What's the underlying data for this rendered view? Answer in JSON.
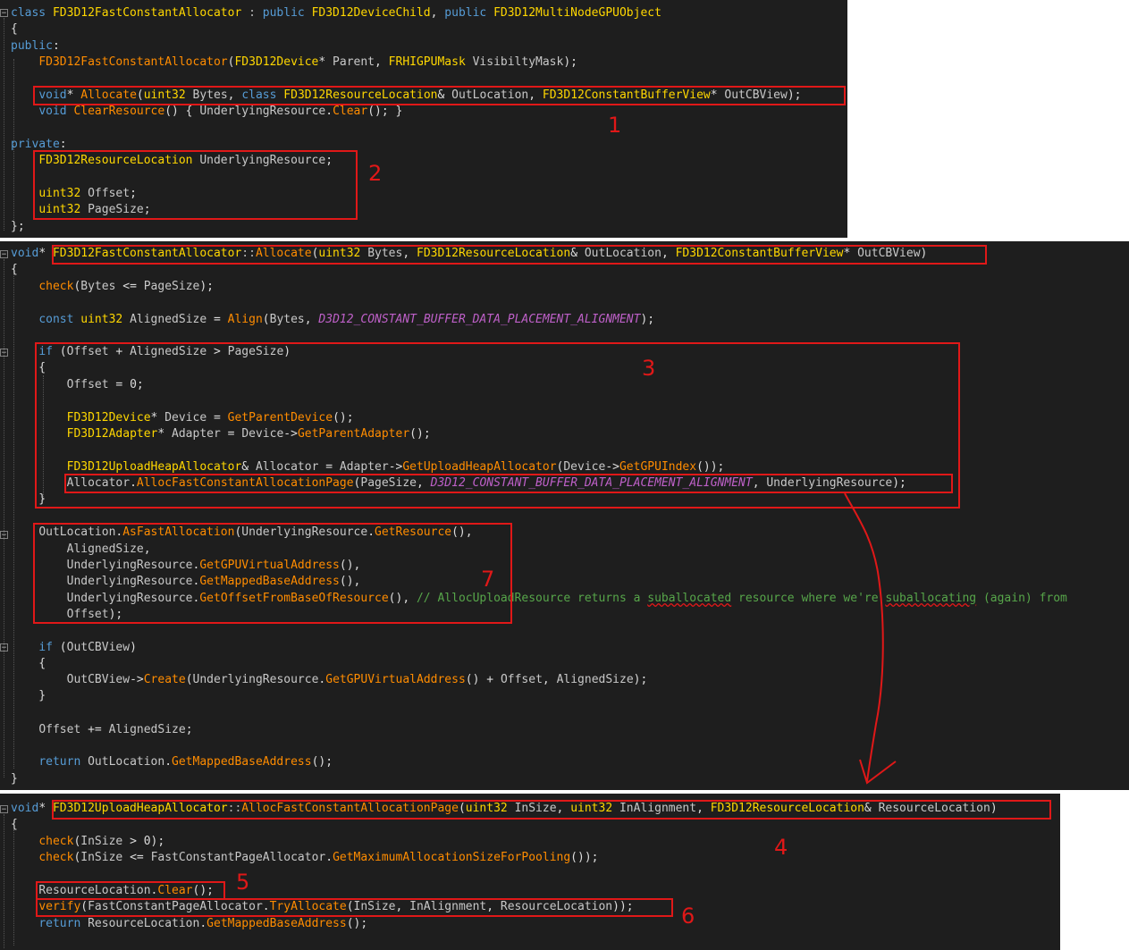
{
  "panel1": {
    "lines": [
      "class FD3D12FastConstantAllocator : public FD3D12DeviceChild, public FD3D12MultiNodeGPUObject",
      "{",
      "public:",
      "    FD3D12FastConstantAllocator(FD3D12Device* Parent, FRHIGPUMask VisibiltyMask);",
      "",
      "    void* Allocate(uint32 Bytes, class FD3D12ResourceLocation& OutLocation, FD3D12ConstantBufferView* OutCBView);",
      "    void ClearResource() { UnderlyingResource.Clear(); }",
      "",
      "private:",
      "    FD3D12ResourceLocation UnderlyingResource;",
      "",
      "    uint32 Offset;",
      "    uint32 PageSize;",
      "};"
    ]
  },
  "panel2": {
    "lines": [
      "void* FD3D12FastConstantAllocator::Allocate(uint32 Bytes, FD3D12ResourceLocation& OutLocation, FD3D12ConstantBufferView* OutCBView)",
      "{",
      "    check(Bytes <= PageSize);",
      "",
      "    const uint32 AlignedSize = Align(Bytes, D3D12_CONSTANT_BUFFER_DATA_PLACEMENT_ALIGNMENT);",
      "",
      "    if (Offset + AlignedSize > PageSize)",
      "    {",
      "        Offset = 0;",
      "",
      "        FD3D12Device* Device = GetParentDevice();",
      "        FD3D12Adapter* Adapter = Device->GetParentAdapter();",
      "",
      "        FD3D12UploadHeapAllocator& Allocator = Adapter->GetUploadHeapAllocator(Device->GetGPUIndex());",
      "        Allocator.AllocFastConstantAllocationPage(PageSize, D3D12_CONSTANT_BUFFER_DATA_PLACEMENT_ALIGNMENT, UnderlyingResource);",
      "    }",
      "",
      "    OutLocation.AsFastAllocation(UnderlyingResource.GetResource(),",
      "        AlignedSize,",
      "        UnderlyingResource.GetGPUVirtualAddress(),",
      "        UnderlyingResource.GetMappedBaseAddress(),",
      "        UnderlyingResource.GetOffsetFromBaseOfResource(), // AllocUploadResource returns a suballocated resource where we're suballocating (again) from",
      "        Offset);",
      "",
      "    if (OutCBView)",
      "    {",
      "        OutCBView->Create(UnderlyingResource.GetGPUVirtualAddress() + Offset, AlignedSize);",
      "    }",
      "",
      "    Offset += AlignedSize;",
      "",
      "    return OutLocation.GetMappedBaseAddress();",
      "}"
    ]
  },
  "panel3": {
    "lines": [
      "void* FD3D12UploadHeapAllocator::AllocFastConstantAllocationPage(uint32 InSize, uint32 InAlignment, FD3D12ResourceLocation& ResourceLocation)",
      "{",
      "    check(InSize > 0);",
      "    check(InSize <= FastConstantPageAllocator.GetMaximumAllocationSizeForPooling());",
      "",
      "    ResourceLocation.Clear();",
      "    verify(FastConstantPageAllocator.TryAllocate(InSize, InAlignment, ResourceLocation));",
      "    return ResourceLocation.GetMappedBaseAddress();"
    ]
  },
  "annotations": {
    "labels": [
      "1",
      "2",
      "3",
      "4",
      "5",
      "6",
      "7"
    ],
    "color": "#e01818"
  },
  "theme": {
    "editor_bg": "#1e1e1e",
    "keyword": "#569cd6",
    "type": "#ffd700",
    "function": "#ff8c00",
    "macro": "#be60c8",
    "comment": "#57a64a"
  },
  "icons": [
    "collapse-icon"
  ]
}
